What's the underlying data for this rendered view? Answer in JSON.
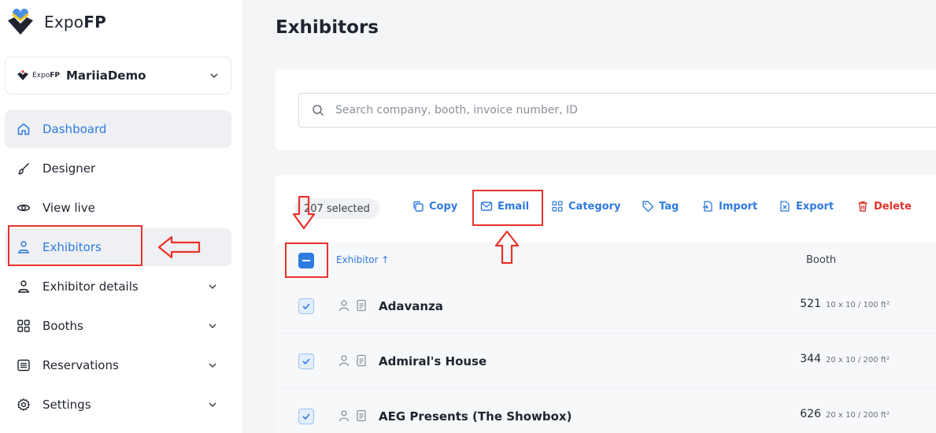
{
  "brand": {
    "name_light": "Expo",
    "name_bold": "FP"
  },
  "workspace": {
    "mini_light": "Expo",
    "mini_bold": "FP",
    "name": "MariiaDemo"
  },
  "sidebar": {
    "items": [
      {
        "label": "Dashboard",
        "icon": "home-icon"
      },
      {
        "label": "Designer",
        "icon": "brush-icon"
      },
      {
        "label": "View live",
        "icon": "eye-icon"
      },
      {
        "label": "Exhibitors",
        "icon": "users-icon"
      },
      {
        "label": "Exhibitor details",
        "icon": "users-icon"
      },
      {
        "label": "Booths",
        "icon": "grid-icon"
      },
      {
        "label": "Reservations",
        "icon": "list-icon"
      },
      {
        "label": "Settings",
        "icon": "gear-icon"
      }
    ]
  },
  "main": {
    "title": "Exhibitors"
  },
  "search": {
    "placeholder": "Search company, booth, invoice number, ID",
    "value": ""
  },
  "toolbar": {
    "selected_label": "207 selected",
    "copy": "Copy",
    "email": "Email",
    "category": "Category",
    "tag": "Tag",
    "import": "Import",
    "export": "Export",
    "delete": "Delete"
  },
  "table": {
    "headers": {
      "exhibitor": "Exhibitor ↑",
      "booth": "Booth"
    },
    "rows": [
      {
        "name": "Adavanza",
        "booth": "521",
        "size": "10 x 10 / 100 ft²",
        "checked": true
      },
      {
        "name": "Admiral's House",
        "booth": "344",
        "size": "20 x 10 / 200 ft²",
        "checked": true
      },
      {
        "name": "AEG Presents (The Showbox)",
        "booth": "626",
        "size": "20 x 10 / 200 ft²",
        "checked": true
      }
    ]
  },
  "colors": {
    "accent": "#2f7ae0",
    "danger": "#e0322b",
    "annotation": "#e8322a"
  }
}
